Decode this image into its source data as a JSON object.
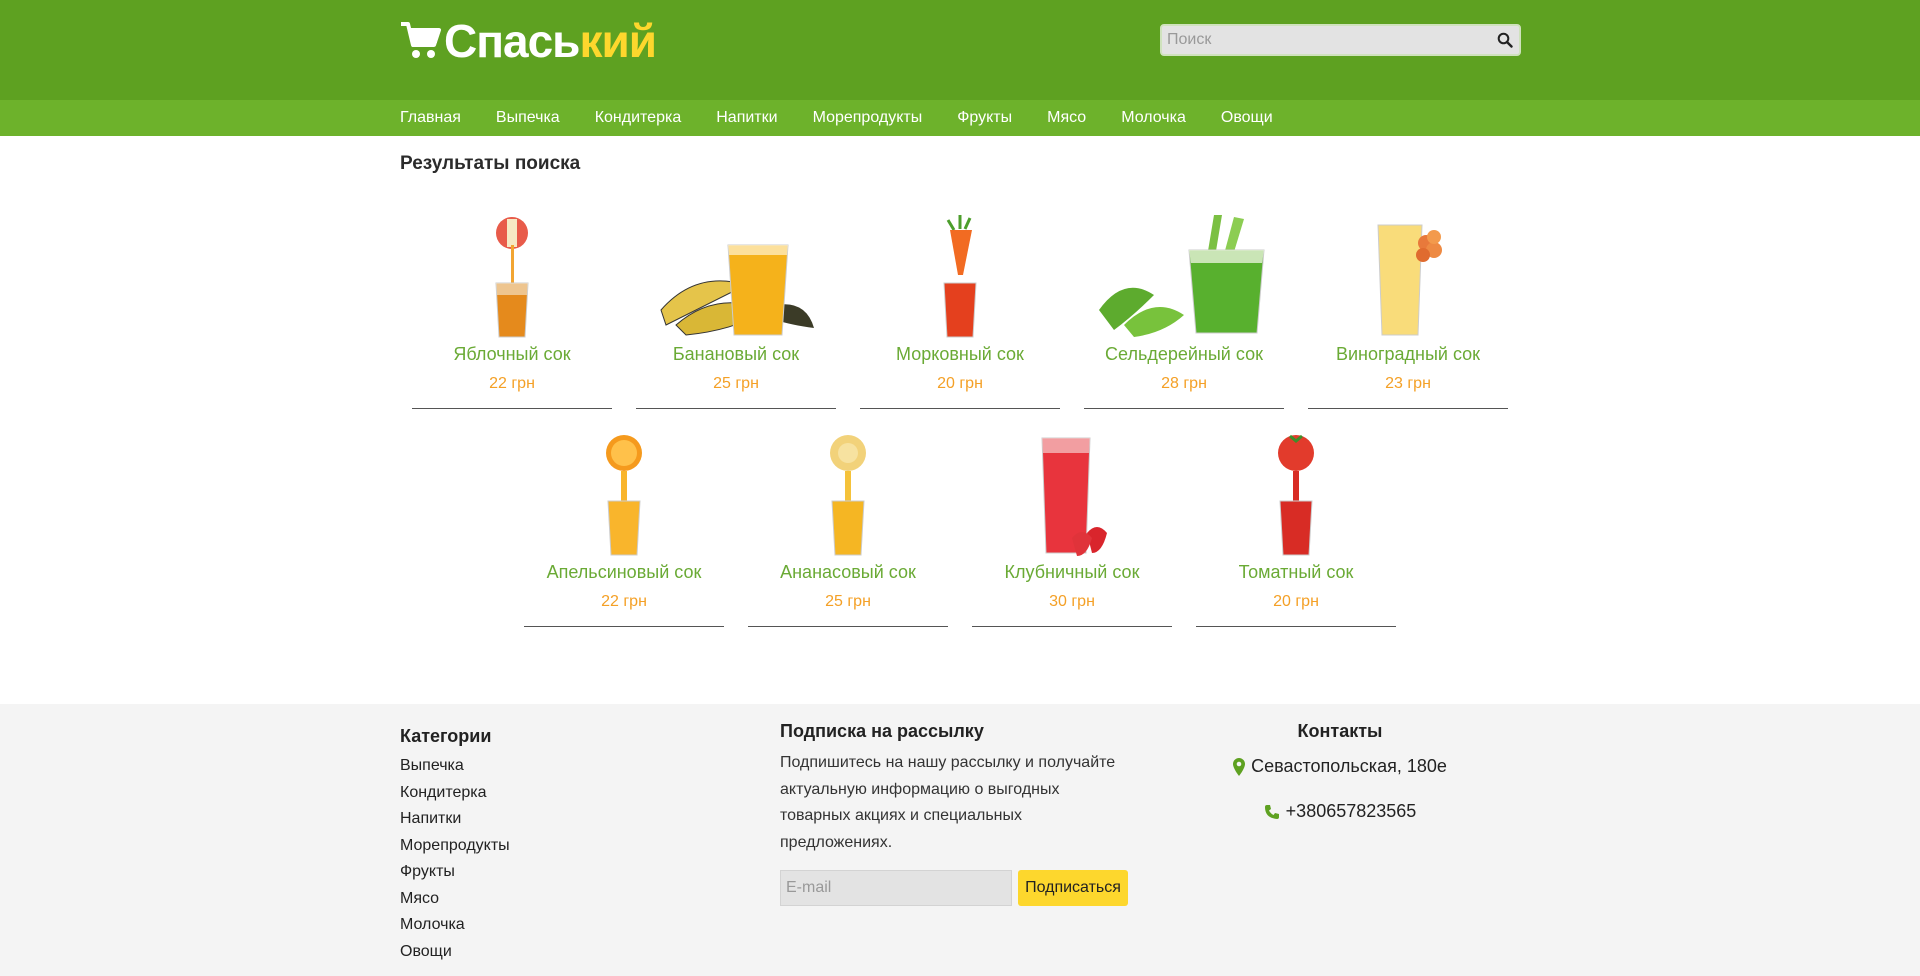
{
  "brand": {
    "part1": "Спась",
    "part2": "кий",
    "accent_color": "#fdd72d",
    "header_color": "#5ea121",
    "nav_color": "#6db22b"
  },
  "search": {
    "placeholder": "Поиск",
    "icon": "search-icon"
  },
  "nav": {
    "items": [
      "Главная",
      "Выпечка",
      "Кондитерка",
      "Напитки",
      "Морепродукты",
      "Фрукты",
      "Мясо",
      "Молочка",
      "Овощи"
    ]
  },
  "results": {
    "title": "Результаты поиска",
    "rows": [
      [
        {
          "name": "Яблочный сок",
          "price": "22 грн",
          "image": "apple-juice"
        },
        {
          "name": "Банановый сок",
          "price": "25 грн",
          "image": "banana-juice"
        },
        {
          "name": "Морковный сок",
          "price": "20 грн",
          "image": "carrot-juice"
        },
        {
          "name": "Сельдерейный сок",
          "price": "28 грн",
          "image": "celery-juice"
        },
        {
          "name": "Виноградный сок",
          "price": "23 грн",
          "image": "grape-juice"
        }
      ],
      [
        {
          "name": "Апельсиновый сок",
          "price": "22 грн",
          "image": "orange-juice"
        },
        {
          "name": "Ананасовый сок",
          "price": "25 грн",
          "image": "pineapple-juice"
        },
        {
          "name": "Клубничный сок",
          "price": "30 грн",
          "image": "strawberry-juice"
        },
        {
          "name": "Томатный сок",
          "price": "20 грн",
          "image": "tomato-juice"
        }
      ]
    ]
  },
  "footer": {
    "categories": {
      "title": "Категории",
      "items": [
        "Выпечка",
        "Кондитерка",
        "Напитки",
        "Морепродукты",
        "Фрукты",
        "Мясо",
        "Молочка",
        "Овощи"
      ]
    },
    "subscribe": {
      "title": "Подписка на рассылку",
      "text": "Подпишитесь на нашу рассылку и получайте актуальную информацию о выгодных товарных акциях и специальных предложениях.",
      "email_placeholder": "E-mail",
      "button_label": "Подписаться"
    },
    "contacts": {
      "title": "Контакты",
      "address": "Севастопольская, 180е",
      "phone": "+380657823565",
      "icon_color": "#5ea121"
    }
  }
}
